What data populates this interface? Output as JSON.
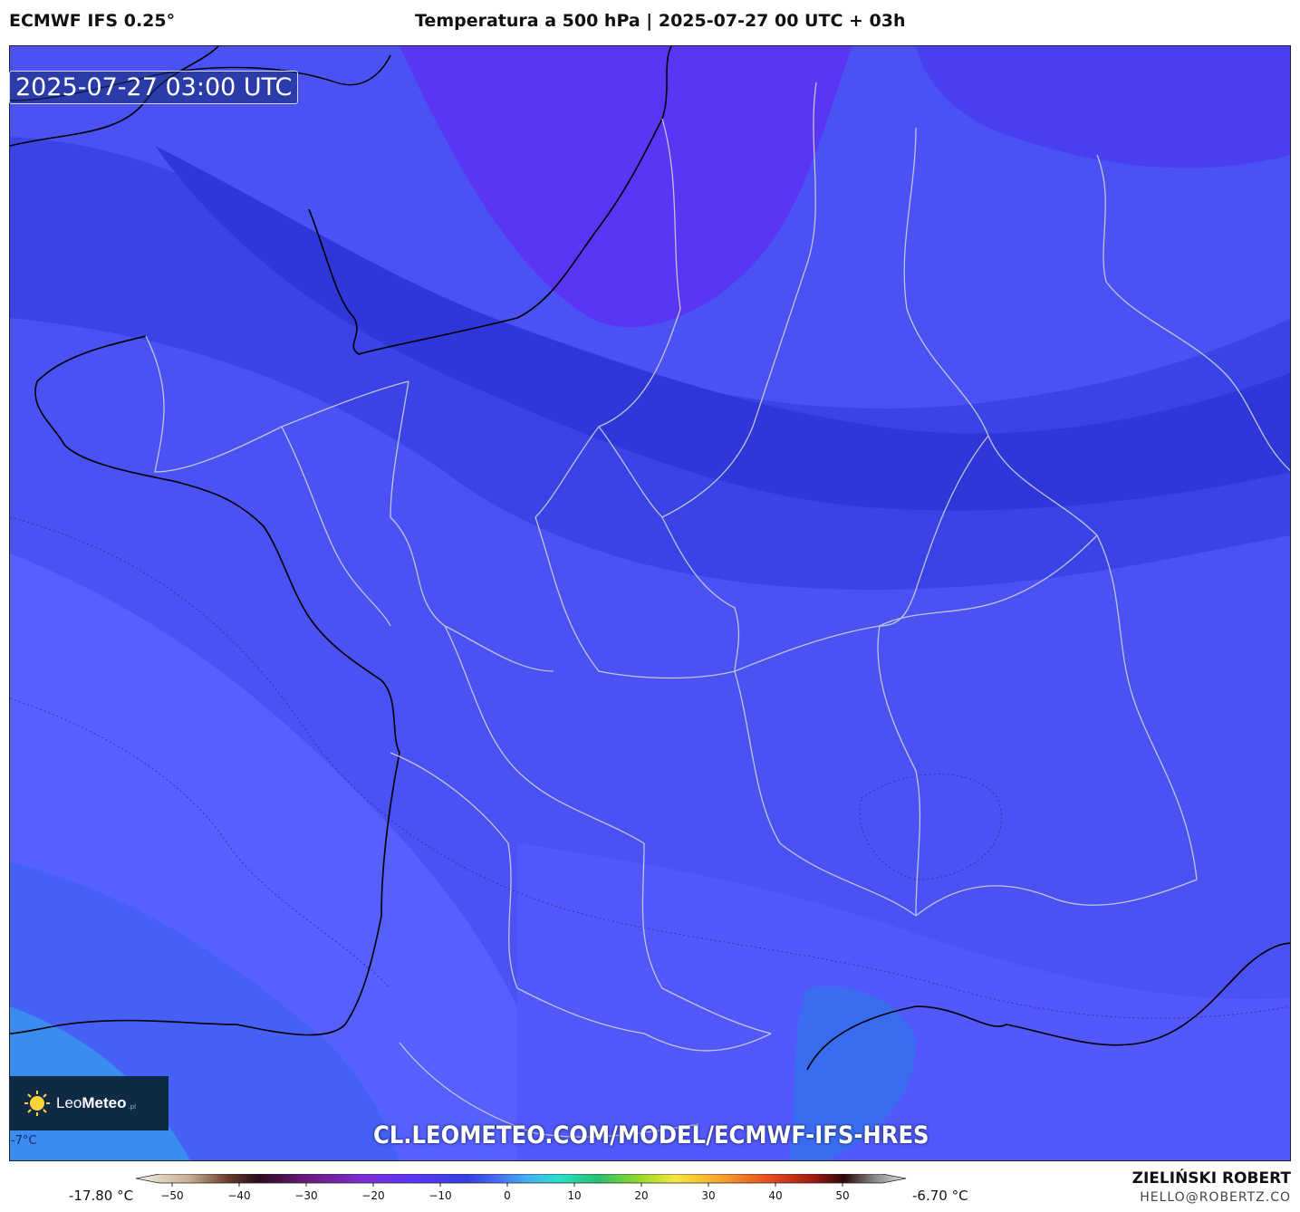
{
  "header": {
    "model": "ECMWF IFS 0.25°",
    "title": "Temperatura a 500 hPa | 2025-07-27 00 UTC + 03h"
  },
  "map": {
    "timestamp": "2025-07-27 03:00 UTC",
    "corner_label": "-7°C",
    "watermark_url": "CL.LEOMETEO.COM/MODEL/ECMWF-IFS-HRES",
    "logo": {
      "brand_light": "Leo",
      "brand_bold": "Meteo",
      "suffix": ".pl",
      "icon": "sun-icon"
    },
    "palette": {
      "coldest": "#2230cc",
      "cold": "#3140e0",
      "mid": "#4450f2",
      "mild": "#5560ff",
      "warmest": "#3a8cf0",
      "violet": "#5a35f5",
      "coastline": "#000000",
      "borders": "#d0d0d8"
    }
  },
  "colorbar": {
    "min_label": "-17.80 °C",
    "max_label": "-6.70 °C",
    "ticks": [
      "−50",
      "−40",
      "−30",
      "−20",
      "−10",
      "0",
      "10",
      "20",
      "30",
      "40",
      "50"
    ]
  },
  "footer": {
    "author": "ZIELIŃSKI ROBERT",
    "email": "HELLO@ROBERTZ.CO"
  }
}
